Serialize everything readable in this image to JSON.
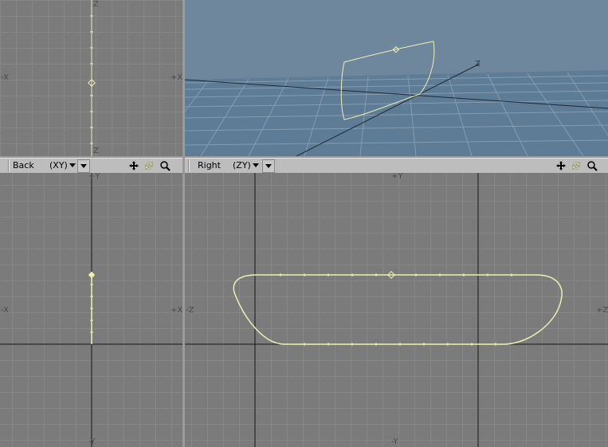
{
  "viewports": {
    "top_left": {
      "axis_top": "Z",
      "axis_bottom": "Z",
      "axis_left": "-X",
      "axis_right": "+X"
    },
    "perspective": {
      "axis_label": "Z"
    },
    "back": {
      "view_name": "Back",
      "axes": "(XY)",
      "axis_top": "+Y",
      "axis_bottom": "-Y",
      "axis_left": "-X",
      "axis_right": "+X"
    },
    "right": {
      "view_name": "Right",
      "axes": "(ZY)",
      "axis_top": "+Y",
      "axis_bottom": "-Y",
      "axis_left": "-Z",
      "axis_right": "+Z"
    }
  },
  "toolbar_icons": [
    "move-icon",
    "rotate-icon",
    "zoom-icon"
  ],
  "colors": {
    "viewport_bg": "#7b7b7b",
    "grid_line": "#878787",
    "perspective_sky": "#6f879c",
    "perspective_floor": "#5f7c96",
    "curve": "#eef0b0",
    "toolbar_bg": "#bdbdbd"
  }
}
